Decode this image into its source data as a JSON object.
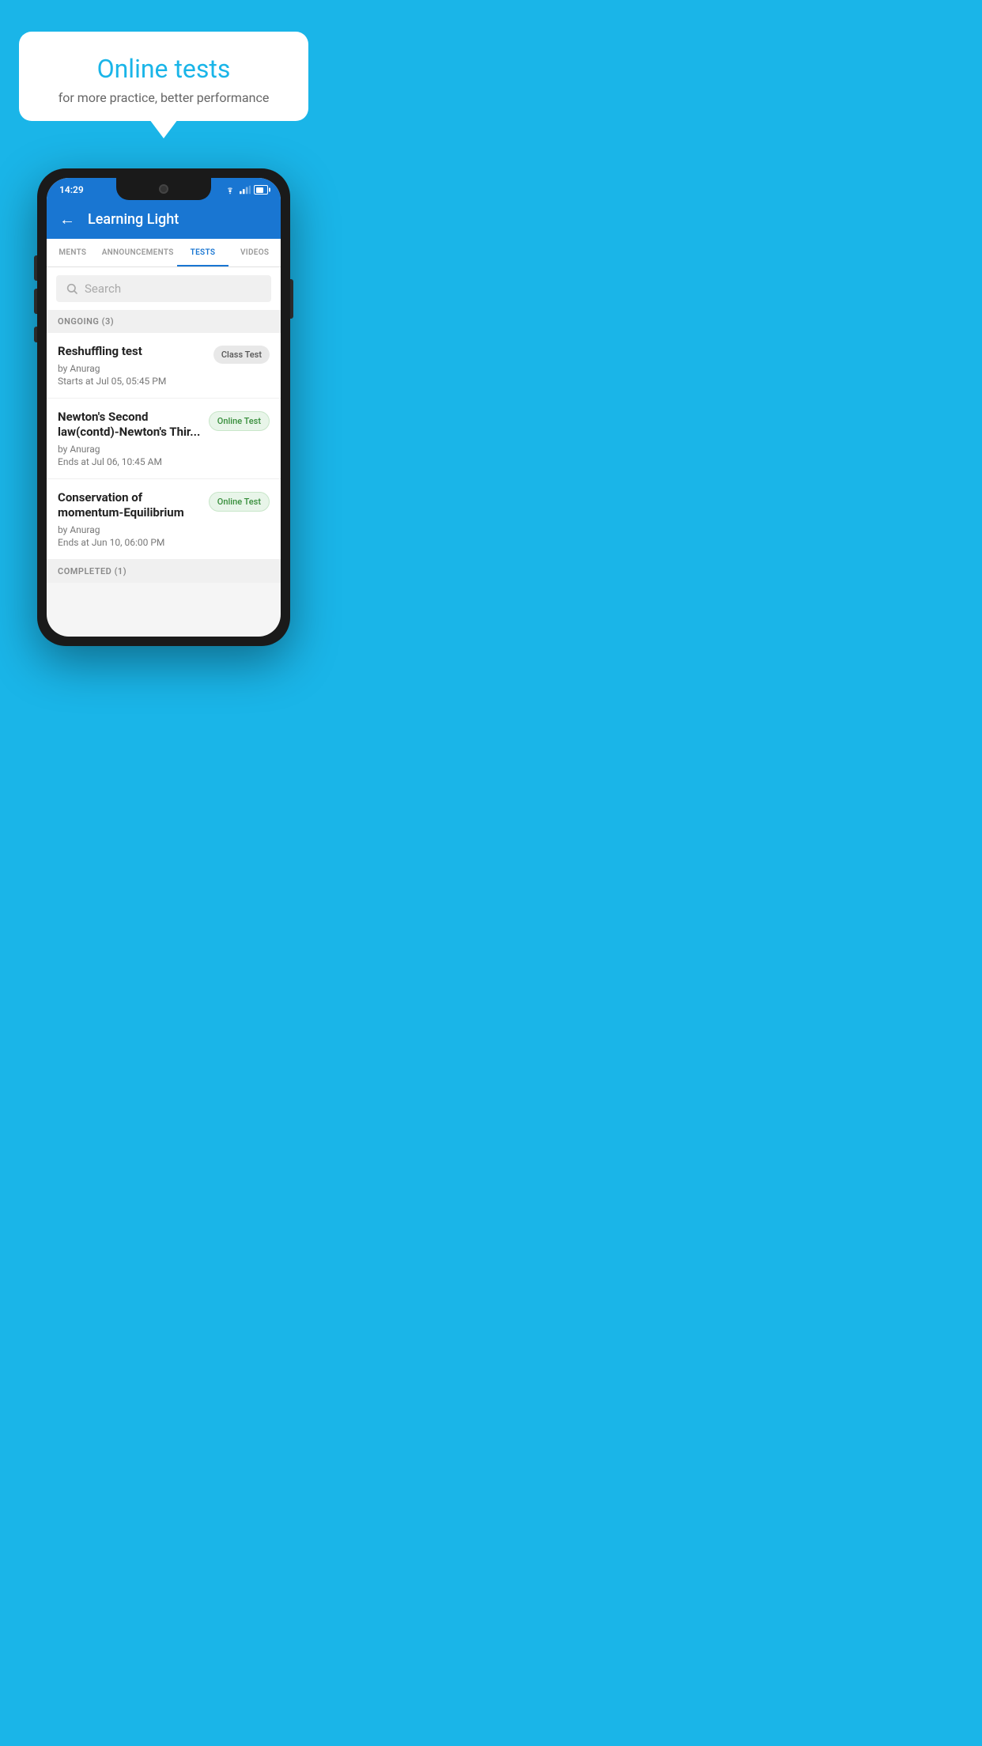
{
  "background_color": "#1ab5e8",
  "speech_bubble": {
    "title": "Online tests",
    "subtitle": "for more practice, better performance"
  },
  "phone": {
    "status_bar": {
      "time": "14:29"
    },
    "app_bar": {
      "title": "Learning Light",
      "back_label": "←"
    },
    "tabs": [
      {
        "label": "MENTS",
        "active": false
      },
      {
        "label": "ANNOUNCEMENTS",
        "active": false
      },
      {
        "label": "TESTS",
        "active": true
      },
      {
        "label": "VIDEOS",
        "active": false
      }
    ],
    "search": {
      "placeholder": "Search"
    },
    "sections": [
      {
        "header": "ONGOING (3)",
        "tests": [
          {
            "name": "Reshuffling test",
            "author": "by Anurag",
            "time": "Starts at  Jul 05, 05:45 PM",
            "badge": "Class Test",
            "badge_type": "class"
          },
          {
            "name": "Newton's Second law(contd)-Newton's Thir...",
            "author": "by Anurag",
            "time": "Ends at  Jul 06, 10:45 AM",
            "badge": "Online Test",
            "badge_type": "online"
          },
          {
            "name": "Conservation of momentum-Equilibrium",
            "author": "by Anurag",
            "time": "Ends at  Jun 10, 06:00 PM",
            "badge": "Online Test",
            "badge_type": "online"
          }
        ]
      }
    ],
    "completed_header": "COMPLETED (1)"
  }
}
